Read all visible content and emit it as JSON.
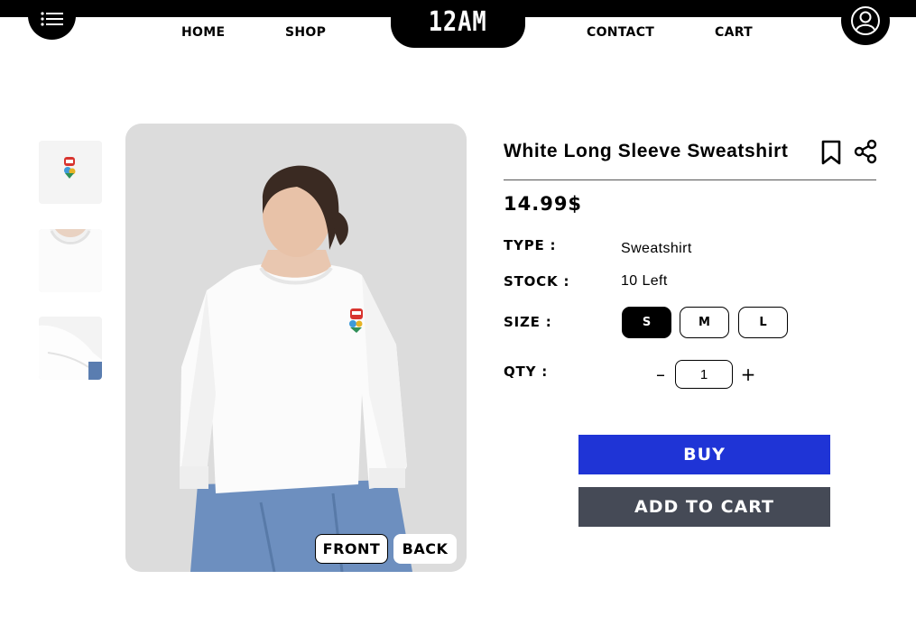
{
  "header": {
    "logo": "12AM",
    "nav": {
      "home": "HOME",
      "shop": "SHOP",
      "contact": "CONTACT",
      "cart": "CART"
    },
    "menu_icon": "hamburger-menu-icon",
    "account_icon": "user-account-icon"
  },
  "gallery": {
    "front_label": "FRONT",
    "back_label": "BACK",
    "selected_view": "FRONT",
    "thumbnail_count": 3
  },
  "product": {
    "title": "White Long Sleeve Sweatshirt",
    "price": "14.99$",
    "type_label": "TYPE :",
    "type_value": "Sweatshirt",
    "stock_label": "STOCK :",
    "stock_value": "10 Left",
    "size_label": "SIZE :",
    "sizes": [
      "S",
      "M",
      "L"
    ],
    "selected_size": "S",
    "qty_label": "QTY :",
    "qty_value": "1",
    "qty_minus": "–",
    "qty_plus": "+",
    "buy_label": "BUY",
    "add_to_cart_label": "ADD TO CART",
    "bookmark_icon": "bookmark-icon",
    "share_icon": "share-icon"
  },
  "colors": {
    "buy_button": "#1f34d6",
    "cart_button": "#454a56",
    "header": "#000000",
    "image_background": "#dcdcdc"
  }
}
